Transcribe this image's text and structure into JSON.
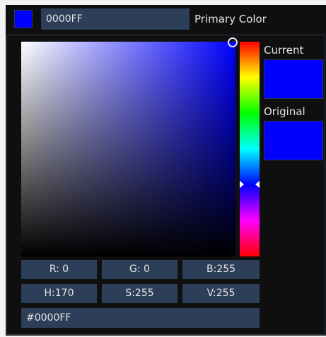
{
  "header": {
    "hex_value": "0000FF",
    "label": "Primary Color"
  },
  "side": {
    "current_label": "Current",
    "original_label": "Original"
  },
  "fields": {
    "r": "R:  0",
    "g": "G:  0",
    "b": "B:255",
    "h": "H:170",
    "s": "S:255",
    "v": "V:255",
    "hex": "#0000FF"
  },
  "colors": {
    "current": "#0000FF",
    "original": "#0000FF",
    "hue": "#0000FF",
    "field_bg": "#2C3E58",
    "panel_bg": "#0F0F0F"
  }
}
